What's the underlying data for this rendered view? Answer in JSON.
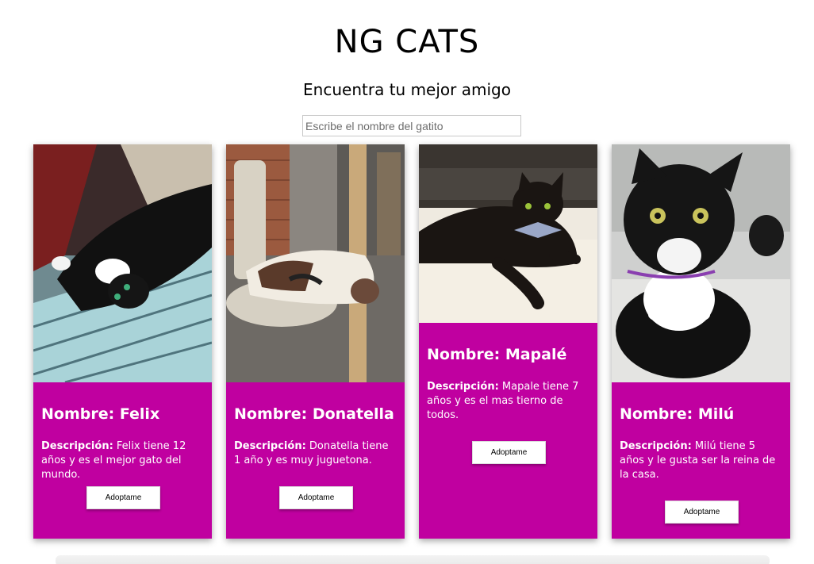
{
  "header": {
    "title": "NG CATS",
    "subtitle": "Encuentra tu mejor amigo"
  },
  "search": {
    "placeholder": "Escribe el nombre del gatito",
    "value": ""
  },
  "colors": {
    "card_bg": "#c000a0",
    "button_bg": "#ffffff"
  },
  "cats": [
    {
      "name": "Nombre: Felix",
      "desc_label": "Descripción:",
      "desc_text": " Felix tiene 12 años y es el mejor gato del mundo.",
      "button": "Adoptame"
    },
    {
      "name": "Nombre: Donatella",
      "desc_label": "Descripción:",
      "desc_text": " Donatella tiene 1 año y es muy juguetona.",
      "button": "Adoptame"
    },
    {
      "name": "Nombre: Mapalé",
      "desc_label": "Descripción:",
      "desc_text": " Mapale tiene 7 años y es el mas tierno de todos.",
      "button": "Adoptame"
    },
    {
      "name": "Nombre: Milú",
      "desc_label": "Descripción:",
      "desc_text": " Milú tiene 5 años y le gusta ser la reina de la casa.",
      "button": "Adoptame"
    }
  ]
}
